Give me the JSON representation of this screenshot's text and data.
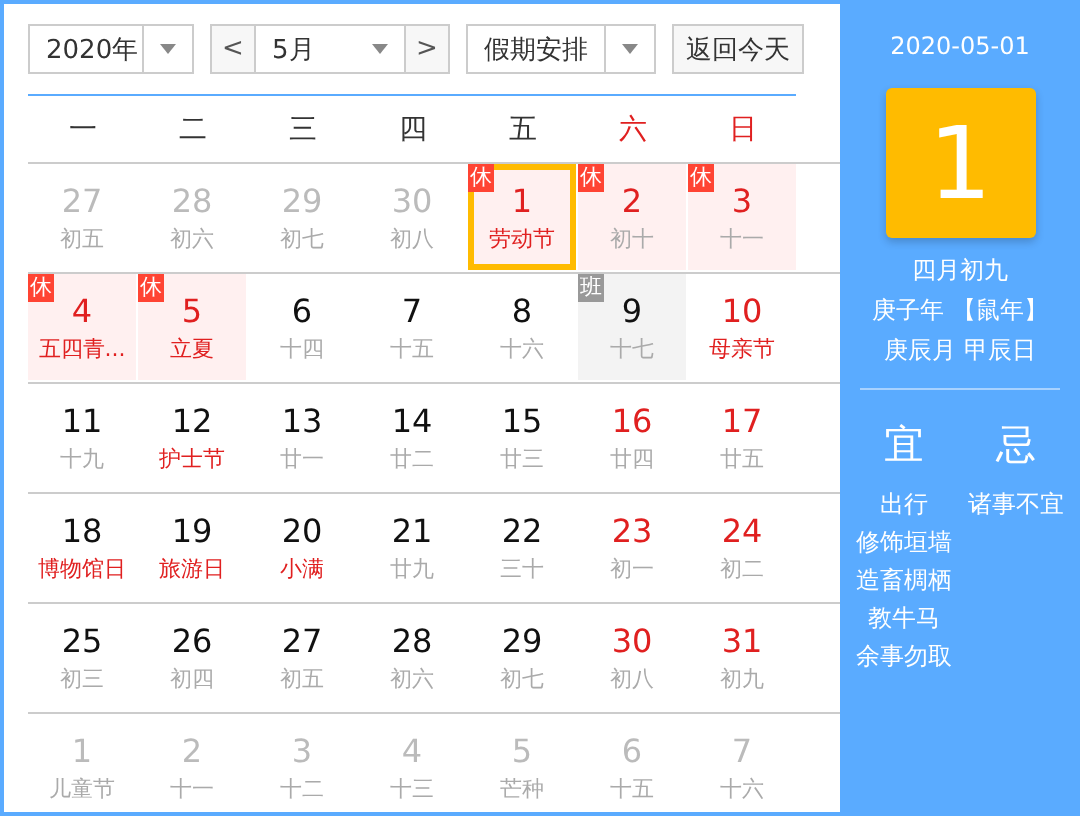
{
  "toolbar": {
    "year": "2020年",
    "month": "5月",
    "prev": "<",
    "next": ">",
    "holiday": "假期安排",
    "today_button": "返回今天"
  },
  "weekdays": [
    {
      "label": "一",
      "weekend": false
    },
    {
      "label": "二",
      "weekend": false
    },
    {
      "label": "三",
      "weekend": false
    },
    {
      "label": "四",
      "weekend": false
    },
    {
      "label": "五",
      "weekend": false
    },
    {
      "label": "六",
      "weekend": true
    },
    {
      "label": "日",
      "weekend": true
    }
  ],
  "weeks": [
    [
      {
        "day": "27",
        "lunar": "初五",
        "muted": true,
        "selected": false
      },
      {
        "day": "28",
        "lunar": "初六",
        "muted": true,
        "selected": false
      },
      {
        "day": "29",
        "lunar": "初七",
        "muted": true,
        "selected": false
      },
      {
        "day": "30",
        "lunar": "初八",
        "muted": true,
        "selected": false
      },
      {
        "day": "1",
        "lunar": "劳动节",
        "muted": false,
        "red": true,
        "festival": true,
        "selected": true,
        "badge": {
          "text": "休",
          "kind": "rest"
        }
      },
      {
        "day": "2",
        "lunar": "初十",
        "muted": false,
        "red": true,
        "festival": false,
        "selected": false,
        "badge": {
          "text": "休",
          "kind": "rest"
        }
      },
      {
        "day": "3",
        "lunar": "十一",
        "muted": false,
        "red": true,
        "festival": false,
        "selected": false,
        "badge": {
          "text": "休",
          "kind": "rest"
        }
      }
    ],
    [
      {
        "day": "4",
        "lunar": "五四青...",
        "muted": false,
        "red": true,
        "festival": true,
        "selected": false,
        "badge": {
          "text": "休",
          "kind": "rest"
        }
      },
      {
        "day": "5",
        "lunar": "立夏",
        "muted": false,
        "red": true,
        "festival": true,
        "selected": false,
        "badge": {
          "text": "休",
          "kind": "rest"
        }
      },
      {
        "day": "6",
        "lunar": "十四",
        "muted": false,
        "red": false,
        "festival": false,
        "selected": false
      },
      {
        "day": "7",
        "lunar": "十五",
        "muted": false,
        "red": false,
        "festival": false,
        "selected": false
      },
      {
        "day": "8",
        "lunar": "十六",
        "muted": false,
        "red": false,
        "festival": false,
        "selected": false
      },
      {
        "day": "9",
        "lunar": "十七",
        "muted": false,
        "red": false,
        "festival": false,
        "selected": false,
        "badge": {
          "text": "班",
          "kind": "work"
        }
      },
      {
        "day": "10",
        "lunar": "母亲节",
        "muted": false,
        "red": true,
        "festival": true,
        "selected": false
      }
    ],
    [
      {
        "day": "11",
        "lunar": "十九",
        "muted": false,
        "red": false,
        "festival": false,
        "selected": false
      },
      {
        "day": "12",
        "lunar": "护士节",
        "muted": false,
        "red": false,
        "festival": true,
        "selected": false
      },
      {
        "day": "13",
        "lunar": "廿一",
        "muted": false,
        "red": false,
        "festival": false,
        "selected": false
      },
      {
        "day": "14",
        "lunar": "廿二",
        "muted": false,
        "red": false,
        "festival": false,
        "selected": false
      },
      {
        "day": "15",
        "lunar": "廿三",
        "muted": false,
        "red": false,
        "festival": false,
        "selected": false
      },
      {
        "day": "16",
        "lunar": "廿四",
        "muted": false,
        "red": true,
        "festival": false,
        "selected": false
      },
      {
        "day": "17",
        "lunar": "廿五",
        "muted": false,
        "red": true,
        "festival": false,
        "selected": false
      }
    ],
    [
      {
        "day": "18",
        "lunar": "博物馆日",
        "muted": false,
        "red": false,
        "festival": true,
        "selected": false
      },
      {
        "day": "19",
        "lunar": "旅游日",
        "muted": false,
        "red": false,
        "festival": true,
        "selected": false
      },
      {
        "day": "20",
        "lunar": "小满",
        "muted": false,
        "red": false,
        "festival": true,
        "selected": false
      },
      {
        "day": "21",
        "lunar": "廿九",
        "muted": false,
        "red": false,
        "festival": false,
        "selected": false
      },
      {
        "day": "22",
        "lunar": "三十",
        "muted": false,
        "red": false,
        "festival": false,
        "selected": false
      },
      {
        "day": "23",
        "lunar": "初一",
        "muted": false,
        "red": true,
        "festival": false,
        "selected": false
      },
      {
        "day": "24",
        "lunar": "初二",
        "muted": false,
        "red": true,
        "festival": false,
        "selected": false
      }
    ],
    [
      {
        "day": "25",
        "lunar": "初三",
        "muted": false,
        "red": false,
        "festival": false,
        "selected": false
      },
      {
        "day": "26",
        "lunar": "初四",
        "muted": false,
        "red": false,
        "festival": false,
        "selected": false
      },
      {
        "day": "27",
        "lunar": "初五",
        "muted": false,
        "red": false,
        "festival": false,
        "selected": false
      },
      {
        "day": "28",
        "lunar": "初六",
        "muted": false,
        "red": false,
        "festival": false,
        "selected": false
      },
      {
        "day": "29",
        "lunar": "初七",
        "muted": false,
        "red": false,
        "festival": false,
        "selected": false
      },
      {
        "day": "30",
        "lunar": "初八",
        "muted": false,
        "red": true,
        "festival": false,
        "selected": false
      },
      {
        "day": "31",
        "lunar": "初九",
        "muted": false,
        "red": true,
        "festival": false,
        "selected": false
      }
    ],
    [
      {
        "day": "1",
        "lunar": "儿童节",
        "muted": true,
        "selected": false
      },
      {
        "day": "2",
        "lunar": "十一",
        "muted": true,
        "selected": false
      },
      {
        "day": "3",
        "lunar": "十二",
        "muted": true,
        "selected": false
      },
      {
        "day": "4",
        "lunar": "十三",
        "muted": true,
        "selected": false
      },
      {
        "day": "5",
        "lunar": "芒种",
        "muted": true,
        "selected": false
      },
      {
        "day": "6",
        "lunar": "十五",
        "muted": true,
        "selected": false
      },
      {
        "day": "7",
        "lunar": "十六",
        "muted": true,
        "selected": false
      }
    ]
  ],
  "detail": {
    "date": "2020-05-01",
    "day": "1",
    "lunar_lines": [
      "四月初九",
      "庚子年 【鼠年】",
      "庚辰月 甲辰日"
    ],
    "yi": {
      "title": "宜",
      "items": [
        "出行",
        "修饰垣墙",
        "造畜椆栖",
        "教牛马",
        "余事勿取"
      ]
    },
    "ji": {
      "title": "忌",
      "items": [
        "诸事不宜"
      ]
    }
  }
}
